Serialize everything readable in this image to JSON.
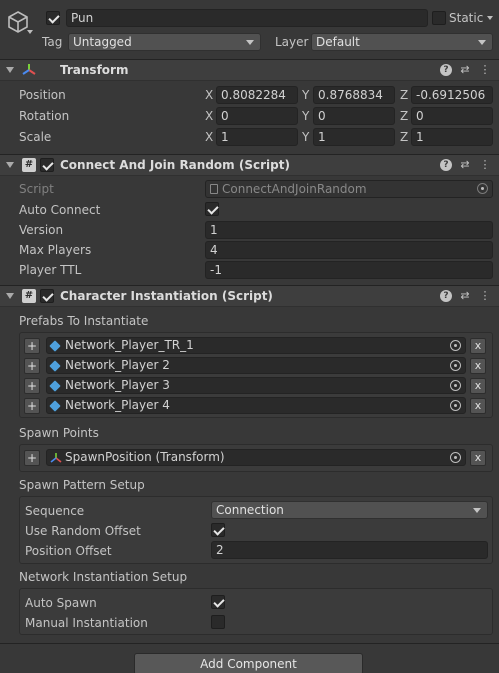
{
  "object": {
    "name": "Pun",
    "static_label": "Static",
    "tag_label": "Tag",
    "tag_value": "Untagged",
    "layer_label": "Layer",
    "layer_value": "Default"
  },
  "transform": {
    "title": "Transform",
    "position_label": "Position",
    "rotation_label": "Rotation",
    "scale_label": "Scale",
    "axis_x": "X",
    "axis_y": "Y",
    "axis_z": "Z",
    "position": [
      "0.8082284",
      "0.8768834",
      "-0.6912506"
    ],
    "rotation": [
      "0",
      "0",
      "0"
    ],
    "scale": [
      "1",
      "1",
      "1"
    ]
  },
  "connect": {
    "title": "Connect And Join Random (Script)",
    "script_label": "Script",
    "script_value": "ConnectAndJoinRandom",
    "auto_connect_label": "Auto Connect",
    "version_label": "Version",
    "version_value": "1",
    "max_players_label": "Max Players",
    "max_players_value": "4",
    "player_ttl_label": "Player TTL",
    "player_ttl_value": "-1"
  },
  "instantiation": {
    "title": "Character Instantiation (Script)",
    "prefabs_label": "Prefabs To Instantiate",
    "prefabs": [
      "Network_Player_TR_1",
      "Network_Player 2",
      "Network_Player 3",
      "Network_Player 4"
    ],
    "spawn_points_label": "Spawn Points",
    "spawn_points": [
      "SpawnPosition (Transform)"
    ],
    "spawn_pattern_label": "Spawn Pattern Setup",
    "sequence_label": "Sequence",
    "sequence_value": "Connection",
    "random_offset_label": "Use Random Offset",
    "position_offset_label": "Position Offset",
    "position_offset_value": "2",
    "network_setup_label": "Network Instantiation Setup",
    "auto_spawn_label": "Auto Spawn",
    "manual_label": "Manual Instantiation",
    "plus": "+",
    "x": "x"
  },
  "footer": {
    "add_component": "Add Component"
  },
  "icons": {
    "help": "?",
    "presets": "⇄",
    "more": "⋮"
  }
}
